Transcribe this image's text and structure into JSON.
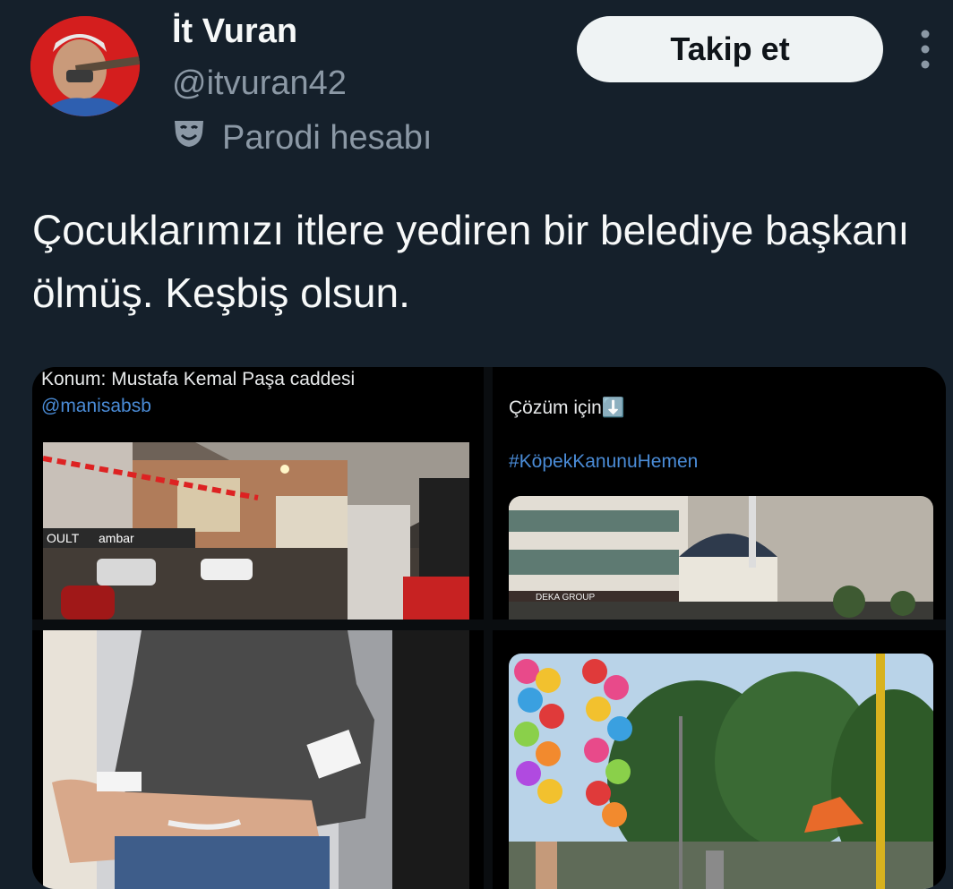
{
  "user": {
    "name": "İt Vuran",
    "handle": "@itvuran42",
    "badge_label": "Parodi hesabı",
    "badge_icon": "theater-mask-icon"
  },
  "actions": {
    "follow_label": "Takip et",
    "more_icon": "more-vertical-icon"
  },
  "tweet": {
    "text": "Çocuklarımızı itlere yediren bir belediye başkanı ölmüş. Keşbiş olsun."
  },
  "media": {
    "image1": {
      "caption": "Konum: Mustafa Kemal Paşa caddesi",
      "mention": "@manisabsb",
      "sign_left": "OULT",
      "sign_right": "ambar"
    },
    "image2": {
      "caption": "Çözüm için⬇️",
      "hashtag": "#KöpekKanunuHemen",
      "sign": "DEKA GROUP"
    },
    "image3": {},
    "image4": {}
  }
}
